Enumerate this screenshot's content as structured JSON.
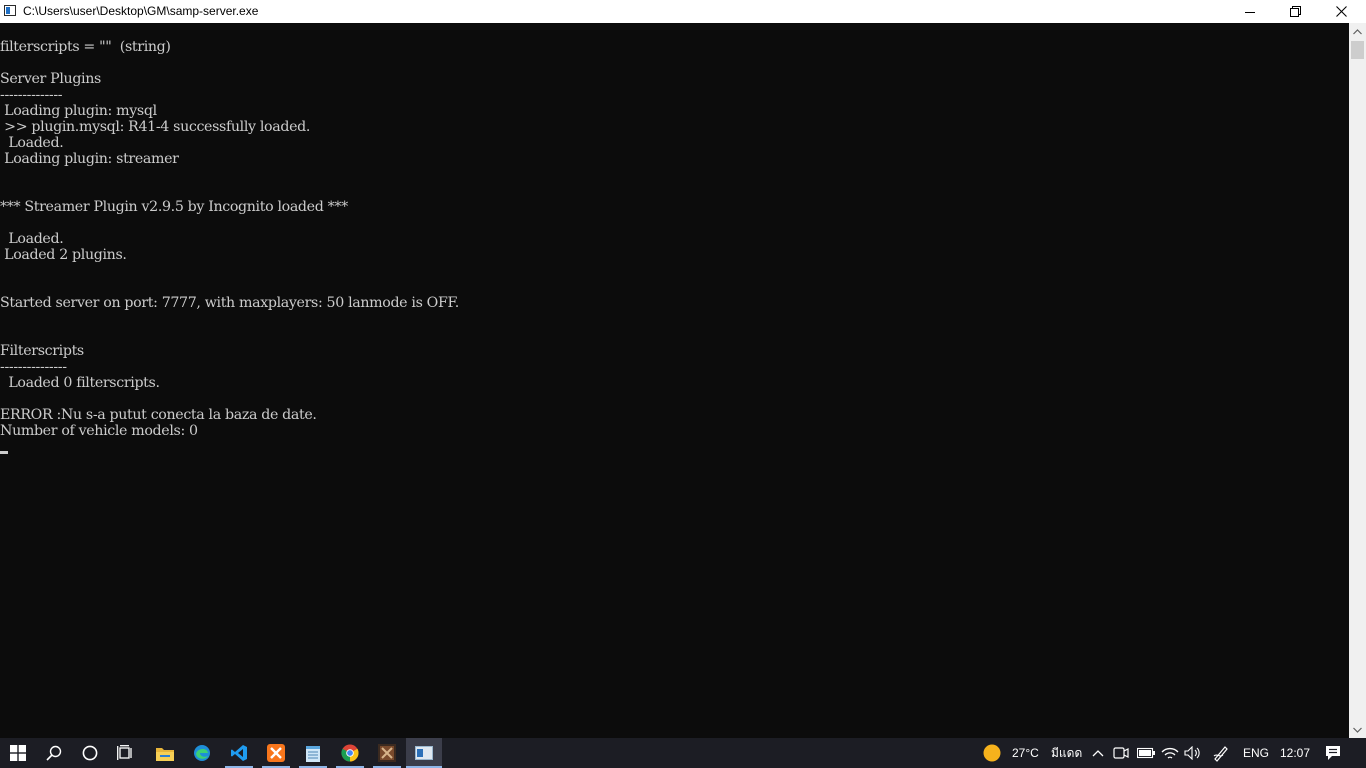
{
  "window": {
    "title": "C:\\Users\\user\\Desktop\\GM\\samp-server.exe",
    "icon": "console-app-icon"
  },
  "console": {
    "lines": [
      "filterscripts = \"\"  (string)",
      "",
      "Server Plugins",
      "--------------",
      " Loading plugin: mysql",
      " >> plugin.mysql: R41-4 successfully loaded.",
      "  Loaded.",
      " Loading plugin: streamer",
      "",
      "",
      "*** Streamer Plugin v2.9.5 by Incognito loaded ***",
      "",
      "  Loaded.",
      " Loaded 2 plugins.",
      "",
      "",
      "Started server on port: 7777, with maxplayers: 50 lanmode is OFF.",
      "",
      "",
      "Filterscripts",
      "---------------",
      "  Loaded 0 filterscripts.",
      "",
      "ERROR :Nu s-a putut conecta la baza de date.",
      "Number of vehicle models: 0"
    ],
    "text_color": "#cccccc",
    "background": "#0c0c0c"
  },
  "taskbar": {
    "apps": [
      {
        "icon": "start-icon"
      },
      {
        "icon": "search-icon"
      },
      {
        "icon": "cortana-icon"
      },
      {
        "icon": "task-view-icon"
      },
      {
        "icon": "file-explorer-icon"
      },
      {
        "icon": "edge-icon"
      },
      {
        "icon": "vscode-icon"
      },
      {
        "icon": "xampp-icon"
      },
      {
        "icon": "notepad-icon"
      },
      {
        "icon": "chrome-icon"
      },
      {
        "icon": "game-app-icon"
      },
      {
        "icon": "console-app-icon"
      }
    ],
    "tray": {
      "weather_temp": "27°C",
      "weather_text": "มีแดด",
      "language": "ENG",
      "time": "12:07"
    }
  }
}
